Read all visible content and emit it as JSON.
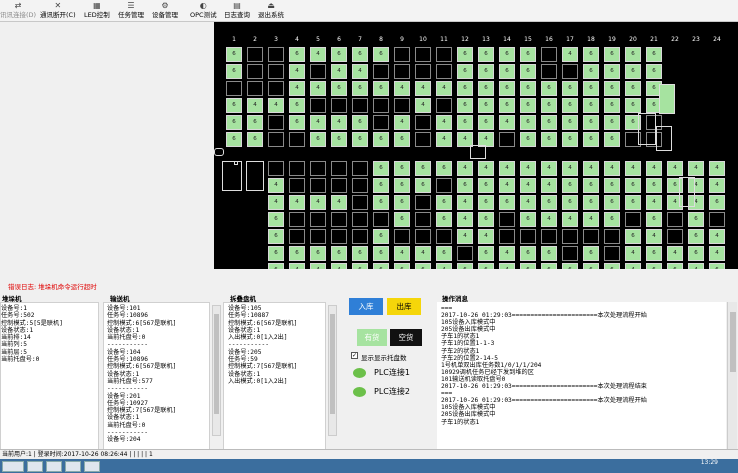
{
  "toolbar": {
    "items": [
      {
        "label": "讯讯连接(D)",
        "icon": "connect-icon",
        "disabled": true
      },
      {
        "label": "通讯断开(C)",
        "icon": "disconnect-icon",
        "disabled": false
      },
      {
        "label": "LED控制",
        "icon": "led-icon",
        "disabled": false
      },
      {
        "label": "任务管理",
        "icon": "task-icon",
        "disabled": false
      },
      {
        "label": "设备管理",
        "icon": "device-icon",
        "disabled": false
      },
      {
        "label": "OPC测试",
        "icon": "opc-icon",
        "disabled": false
      },
      {
        "label": "日志查询",
        "icon": "log-icon",
        "disabled": false
      },
      {
        "label": "退出系统",
        "icon": "exit-icon",
        "disabled": false
      }
    ]
  },
  "warehouse": {
    "column_numbers": [
      "1",
      "2",
      "3",
      "4",
      "5",
      "6",
      "7",
      "8",
      "9",
      "10",
      "11",
      "12",
      "13",
      "14",
      "15",
      "16",
      "17",
      "18",
      "19",
      "20",
      "21",
      "22",
      "23",
      "24"
    ],
    "upper_rack": [
      [
        "6",
        "",
        "",
        "6",
        "4",
        "6",
        "6",
        "6",
        "",
        "",
        "",
        "6",
        "6",
        "6",
        "6",
        "",
        "4",
        "6",
        "6",
        "6",
        "6"
      ],
      [
        "6",
        "",
        "",
        "4",
        "",
        "4",
        "4",
        "",
        "",
        "",
        "",
        "6",
        "6",
        "6",
        "6",
        "",
        "",
        "6",
        "6",
        "6",
        "6"
      ],
      [
        "",
        "",
        "",
        "4",
        "4",
        "6",
        "6",
        "6",
        "4",
        "4",
        "4",
        "6",
        "6",
        "6",
        "6",
        "6",
        "6",
        "6",
        "6",
        "6",
        "6"
      ],
      [
        "6",
        "4",
        "4",
        "6",
        "",
        "",
        "",
        "",
        "",
        "4",
        "",
        "6",
        "6",
        "6",
        "6",
        "6",
        "6",
        "6",
        "6",
        "6",
        "6"
      ],
      [
        "6",
        "6",
        "",
        "6",
        "4",
        "4",
        "6",
        "",
        "4",
        "",
        "4",
        "6",
        "6",
        "4",
        "6",
        "6",
        "6",
        "6",
        "6",
        "6",
        ""
      ],
      [
        "6",
        "6",
        "",
        "",
        "6",
        "6",
        "6",
        "6",
        "6",
        "",
        "4",
        "4",
        "4",
        "",
        "6",
        "6",
        "6",
        "6",
        "6",
        "",
        ""
      ]
    ],
    "lower_rack": [
      [
        "",
        "",
        "",
        "",
        "",
        "6",
        "6",
        "6",
        "6",
        "4",
        "4",
        "4",
        "4",
        "4",
        "4",
        "4",
        "4",
        "4",
        "4",
        "4",
        "4",
        "4"
      ],
      [
        "4",
        "",
        "",
        "",
        "",
        "6",
        "6",
        "6",
        "",
        "6",
        "6",
        "4",
        "4",
        "4",
        "6",
        "6",
        "6",
        "6",
        "6",
        "6",
        "4",
        "4"
      ],
      [
        "4",
        "4",
        "4",
        "4",
        "",
        "6",
        "6",
        "",
        "6",
        "4",
        "6",
        "6",
        "4",
        "6",
        "6",
        "6",
        "6",
        "6",
        "4",
        "4",
        "4",
        "6"
      ],
      [
        "6",
        "",
        "",
        "",
        "",
        "",
        "6",
        "",
        "6",
        "4",
        "6",
        "",
        "6",
        "4",
        "4",
        "4",
        "6",
        "",
        "6",
        "",
        "6",
        ""
      ],
      [
        "6",
        "",
        "",
        "",
        "",
        "6",
        "",
        "",
        "",
        "4",
        "4",
        "",
        "",
        "",
        "",
        "",
        "",
        "6",
        "4",
        "",
        "6",
        "4"
      ],
      [
        "6",
        "6",
        "6",
        "6",
        "6",
        "6",
        "4",
        "4",
        "6",
        "",
        "6",
        "4",
        "6",
        "6",
        "",
        "6",
        "",
        "4",
        "6",
        "4",
        "6",
        "4"
      ],
      [
        "6",
        "4",
        "4",
        "4",
        "6",
        "6",
        "6",
        "6",
        "4",
        "6",
        "6",
        "4",
        "6",
        "6",
        "6",
        "6",
        "6",
        "4",
        "6",
        "6",
        "4",
        "6"
      ]
    ]
  },
  "log_label": "错误日志: 堆垛机命令运行超时",
  "stacker": {
    "title": "堆垛机",
    "lines": [
      "设备号:1",
      "任务号:502",
      "控制模式:5[5是联机]",
      "设备状态:1",
      "当前排:14",
      "当前列:5",
      "当前层:5",
      "当前托盘号:0"
    ]
  },
  "conveyor": {
    "title": "输送机",
    "lines": [
      "设备号:101",
      "任务号:10896",
      "控制模式:6[567是联机]",
      "设备状态:1",
      "当前托盘号:0",
      "-----------",
      "设备号:104",
      "任务号:10896",
      "控制模式:6[567是联机]",
      "设备状态:1",
      "当前托盘号:577",
      "-----------",
      "设备号:201",
      "任务号:10927",
      "控制模式:7[567是联机]",
      "设备状态:1",
      "当前托盘号:0",
      "-----------",
      "设备号:204"
    ]
  },
  "rgv": {
    "title": "拆叠盘机",
    "lines": [
      "设备号:105",
      "任务号:10887",
      "控制模式:6[567是联机]",
      "设备状态:1",
      "入出模式:0[1入2出]",
      "-----------",
      "设备号:205",
      "任务号:59",
      "控制模式:7[567是联机]",
      "设备状态:1",
      "入出模式:0[1入2出]"
    ]
  },
  "controls": {
    "inbound": "入库",
    "outbound": "出库",
    "has_goods": "有货",
    "empty": "空货",
    "checkbox_label": "显示显示托盘数",
    "plc1": "PLC连接1",
    "plc2": "PLC连接2"
  },
  "messages": {
    "title": "操作消息",
    "lines": [
      "===",
      "2017-10-26 01:29:03=======================本次处理流程开始",
      "105设备入库模式中",
      "205设备出库模式中",
      "子车1的状态1",
      "子车1的位置1-1-3",
      "子车2的状态1",
      "子车2的位置2-14-5",
      "1号机单双出库任务数1/0/1/1/204",
      "10929调机任务已经下发到堆的区",
      "101输送机读取托盘号0",
      "2017-10-26 01:29:03=======================本次处理流程结束",
      "===",
      "2017-10-26 01:29:03=======================本次处理流程开始",
      "105设备入库模式中",
      "205设备出库模式中",
      "子车1的状态1"
    ]
  },
  "status_bar": "当前用户:1 | 登录时间:2017-10-26 08:26:44 | | | | | 1",
  "taskbar": {
    "time": "13:29"
  },
  "colors": {
    "full": "#a6e3a0",
    "empty": "#000000",
    "inbound": "#2f7fd7",
    "outbound": "#f5d60a",
    "led": "#6cc04a"
  }
}
